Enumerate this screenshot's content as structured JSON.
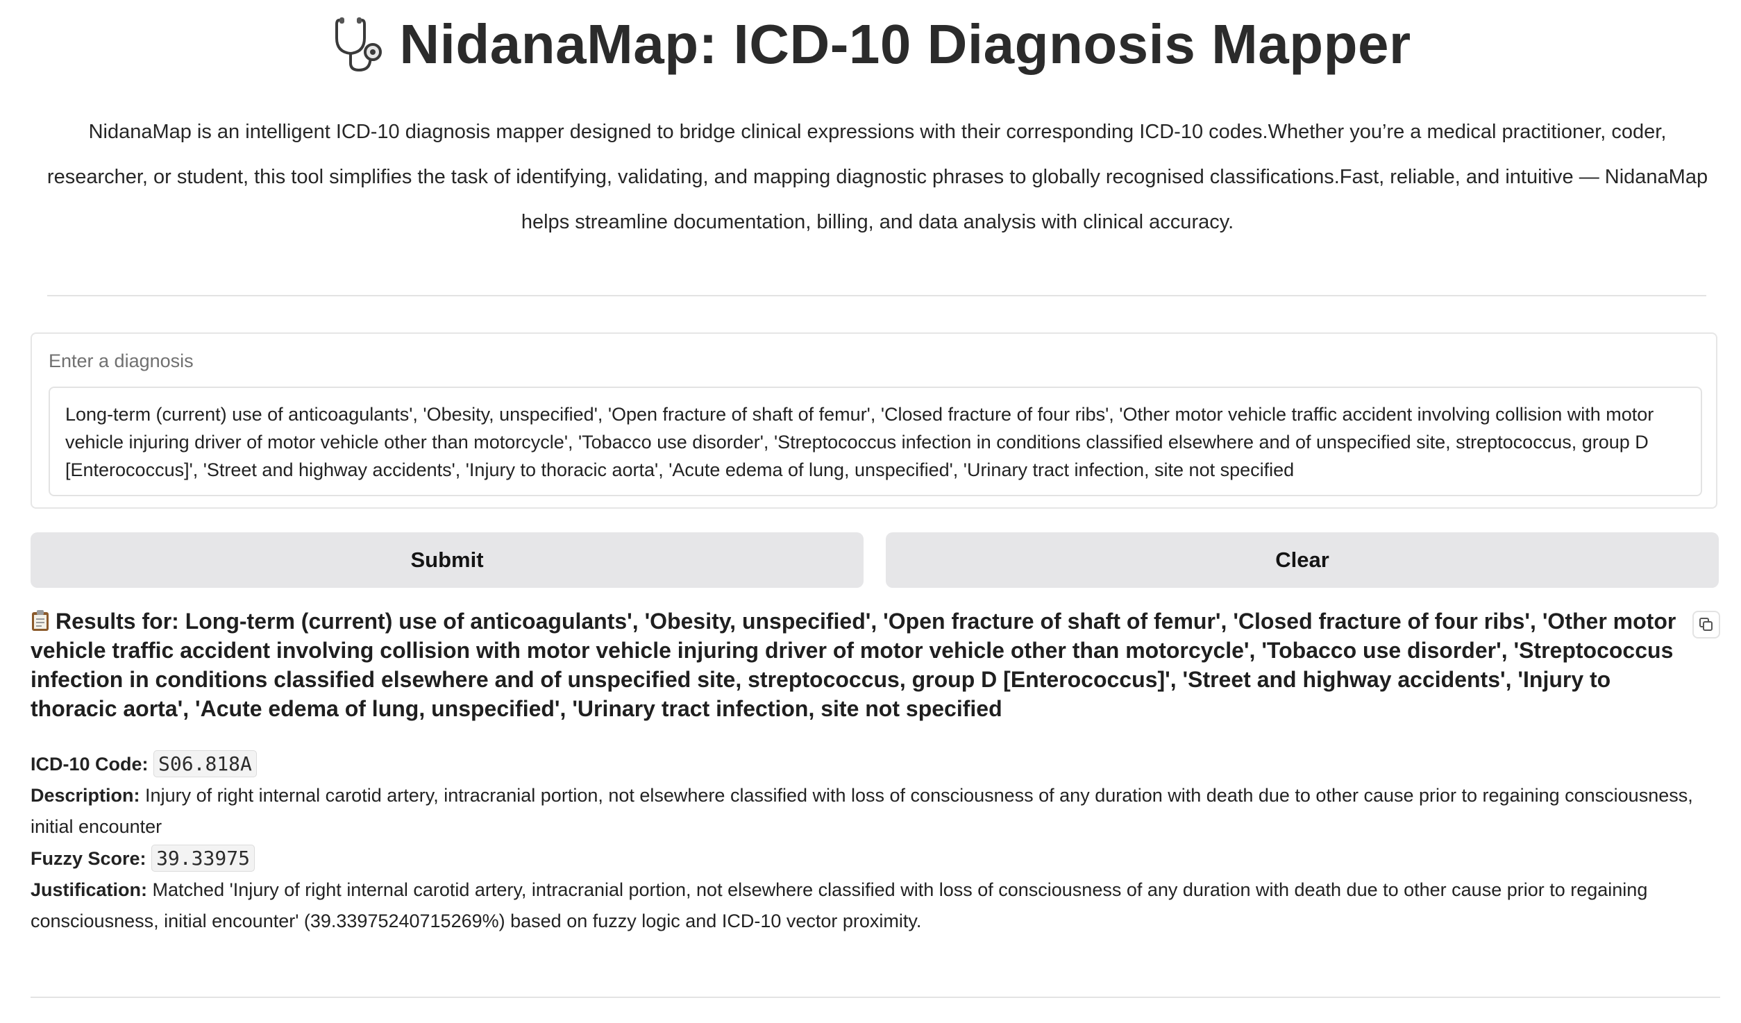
{
  "header": {
    "title": "NidanaMap: ICD-10 Diagnosis Mapper",
    "icon": "stethoscope-icon",
    "intro": "NidanaMap is an intelligent ICD-10 diagnosis mapper designed to bridge clinical expressions with their corresponding ICD-10 codes.Whether you’re a medical practitioner, coder, researcher, or student, this tool simplifies the task of identifying, validating, and mapping diagnostic phrases to globally recognised classifications.Fast, reliable, and intuitive — NidanaMap helps streamline documentation, billing, and data analysis with clinical accuracy."
  },
  "input": {
    "label": "Enter a diagnosis",
    "value": "Long-term (current) use of anticoagulants', 'Obesity, unspecified', 'Open fracture of shaft of femur', 'Closed fracture of four ribs', 'Other motor vehicle traffic accident involving collision with motor vehicle injuring driver of motor vehicle other than motorcycle', 'Tobacco use disorder', 'Streptococcus infection in conditions classified elsewhere and of unspecified site, streptococcus, group D [Enterococcus]', 'Street and highway accidents', 'Injury to thoracic aorta', 'Acute edema of lung, unspecified', 'Urinary tract infection, site not specified"
  },
  "buttons": {
    "submit_label": "Submit",
    "clear_label": "Clear"
  },
  "results": {
    "icon": "clipboard-icon",
    "heading": "Results for: Long-term (current) use of anticoagulants', 'Obesity, unspecified', 'Open fracture of shaft of femur', 'Closed fracture of four ribs', 'Other motor vehicle traffic accident involving collision with motor vehicle injuring driver of motor vehicle other than motorcycle', 'Tobacco use disorder', 'Streptococcus infection in conditions classified elsewhere and of unspecified site, streptococcus, group D [Enterococcus]', 'Street and highway accidents', 'Injury to thoracic aorta', 'Acute edema of lung, unspecified', 'Urinary tract infection, site not specified",
    "copy_icon": "copy-icon",
    "code_label": "ICD-10 Code:",
    "code_value": "S06.818A",
    "description_label": "Description:",
    "description_value": "Injury of right internal carotid artery, intracranial portion, not elsewhere classified with loss of consciousness of any duration with death due to other cause prior to regaining consciousness, initial encounter",
    "score_label": "Fuzzy Score:",
    "score_value": "39.33975",
    "justification_label": "Justification:",
    "justification_value": "Matched 'Injury of right internal carotid artery, intracranial portion, not elsewhere classified with loss of consciousness of any duration with death due to other cause prior to regaining consciousness, initial encounter' (39.33975240715269%) based on fuzzy logic and ICD-10 vector proximity."
  }
}
